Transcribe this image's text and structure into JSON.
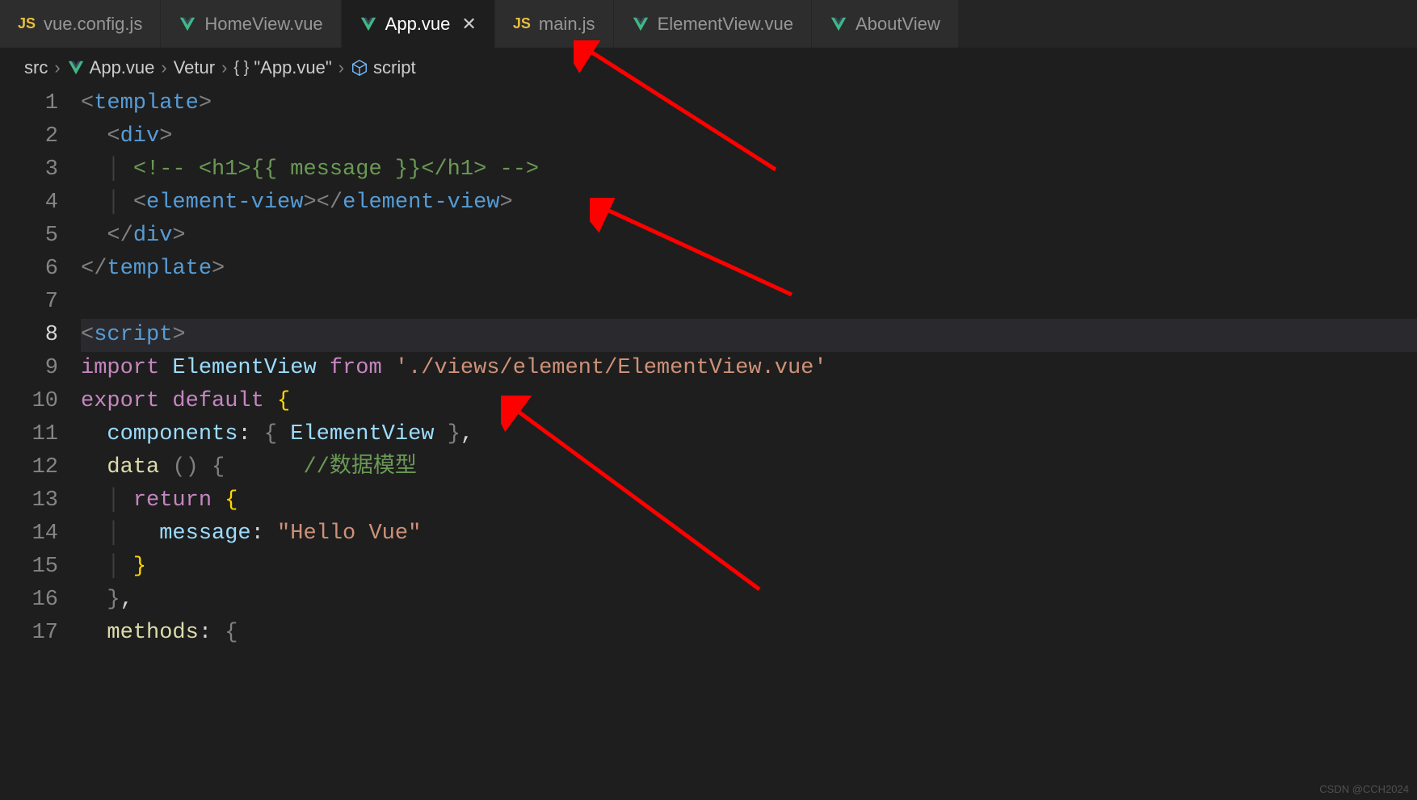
{
  "tabs": [
    {
      "icon": "js",
      "label": "vue.config.js",
      "active": false,
      "close": false
    },
    {
      "icon": "vue",
      "label": "HomeView.vue",
      "active": false,
      "close": false
    },
    {
      "icon": "vue",
      "label": "App.vue",
      "active": true,
      "close": true
    },
    {
      "icon": "js",
      "label": "main.js",
      "active": false,
      "close": false
    },
    {
      "icon": "vue",
      "label": "ElementView.vue",
      "active": false,
      "close": false
    },
    {
      "icon": "vue",
      "label": "AboutView",
      "active": false,
      "close": false
    }
  ],
  "breadcrumb": {
    "items": [
      {
        "icon": null,
        "label": "src"
      },
      {
        "icon": "vue",
        "label": "App.vue"
      },
      {
        "icon": null,
        "label": "Vetur"
      },
      {
        "icon": "braces",
        "label": "\"App.vue\""
      },
      {
        "icon": "cube",
        "label": "script"
      }
    ]
  },
  "editor": {
    "lines": [
      {
        "num": "1",
        "html": "<span class='c-punc'>&lt;</span><span class='c-tag'>template</span><span class='c-punc'>&gt;</span>"
      },
      {
        "num": "2",
        "html": "  <span class='c-punc'>&lt;</span><span class='c-tag'>div</span><span class='c-punc'>&gt;</span>"
      },
      {
        "num": "3",
        "html": "  <span class='guide'>│ </span><span class='c-comment'>&lt;!-- &lt;h1&gt;{{ message }}&lt;/h1&gt; --&gt;</span>"
      },
      {
        "num": "4",
        "html": "  <span class='guide'>│ </span><span class='c-punc'>&lt;</span><span class='c-tag'>element-view</span><span class='c-punc'>&gt;&lt;/</span><span class='c-tag'>element-view</span><span class='c-punc'>&gt;</span>"
      },
      {
        "num": "5",
        "html": "  <span class='c-punc'>&lt;/</span><span class='c-tag'>div</span><span class='c-punc'>&gt;</span>"
      },
      {
        "num": "6",
        "html": "<span class='c-punc'>&lt;/</span><span class='c-tag'>template</span><span class='c-punc'>&gt;</span>"
      },
      {
        "num": "7",
        "html": ""
      },
      {
        "num": "8",
        "html": "<span class='c-punc'>&lt;</span><span class='c-tag'>script</span><span class='c-punc'>&gt;</span>",
        "current": true
      },
      {
        "num": "9",
        "html": "<span class='c-keyword'>import</span> <span class='c-var'>ElementView</span> <span class='c-keyword'>from</span> <span class='c-string'>'./views/element/ElementView.vue'</span>"
      },
      {
        "num": "10",
        "html": "<span class='c-keyword'>export</span> <span class='c-keyword'>default</span> <span class='c-brace'>{</span>"
      },
      {
        "num": "11",
        "html": "  <span class='c-var'>components</span><span class='c-text'>:</span> <span class='c-punc'>{</span> <span class='c-var'>ElementView</span> <span class='c-punc'>}</span><span class='c-text'>,</span>"
      },
      {
        "num": "12",
        "html": "  <span class='c-func'>data</span> <span class='c-punc'>() {</span>      <span class='c-comment'>//数据模型</span>"
      },
      {
        "num": "13",
        "html": "  <span class='guide'>│ </span><span class='c-keyword'>return</span> <span class='c-brace'>{</span>"
      },
      {
        "num": "14",
        "html": "  <span class='guide'>│ </span>  <span class='c-var'>message</span><span class='c-text'>:</span> <span class='c-string'>\"Hello Vue\"</span>"
      },
      {
        "num": "15",
        "html": "  <span class='guide'>│ </span><span class='c-brace'>}</span>"
      },
      {
        "num": "16",
        "html": "  <span class='c-punc'>}</span><span class='c-text'>,</span>"
      },
      {
        "num": "17",
        "html": "  <span class='c-func'>methods</span><span class='c-text'>:</span> <span class='c-punc'>{</span>"
      }
    ]
  },
  "watermark": "CSDN @CCH2024",
  "icons": {
    "js_label": "JS"
  }
}
